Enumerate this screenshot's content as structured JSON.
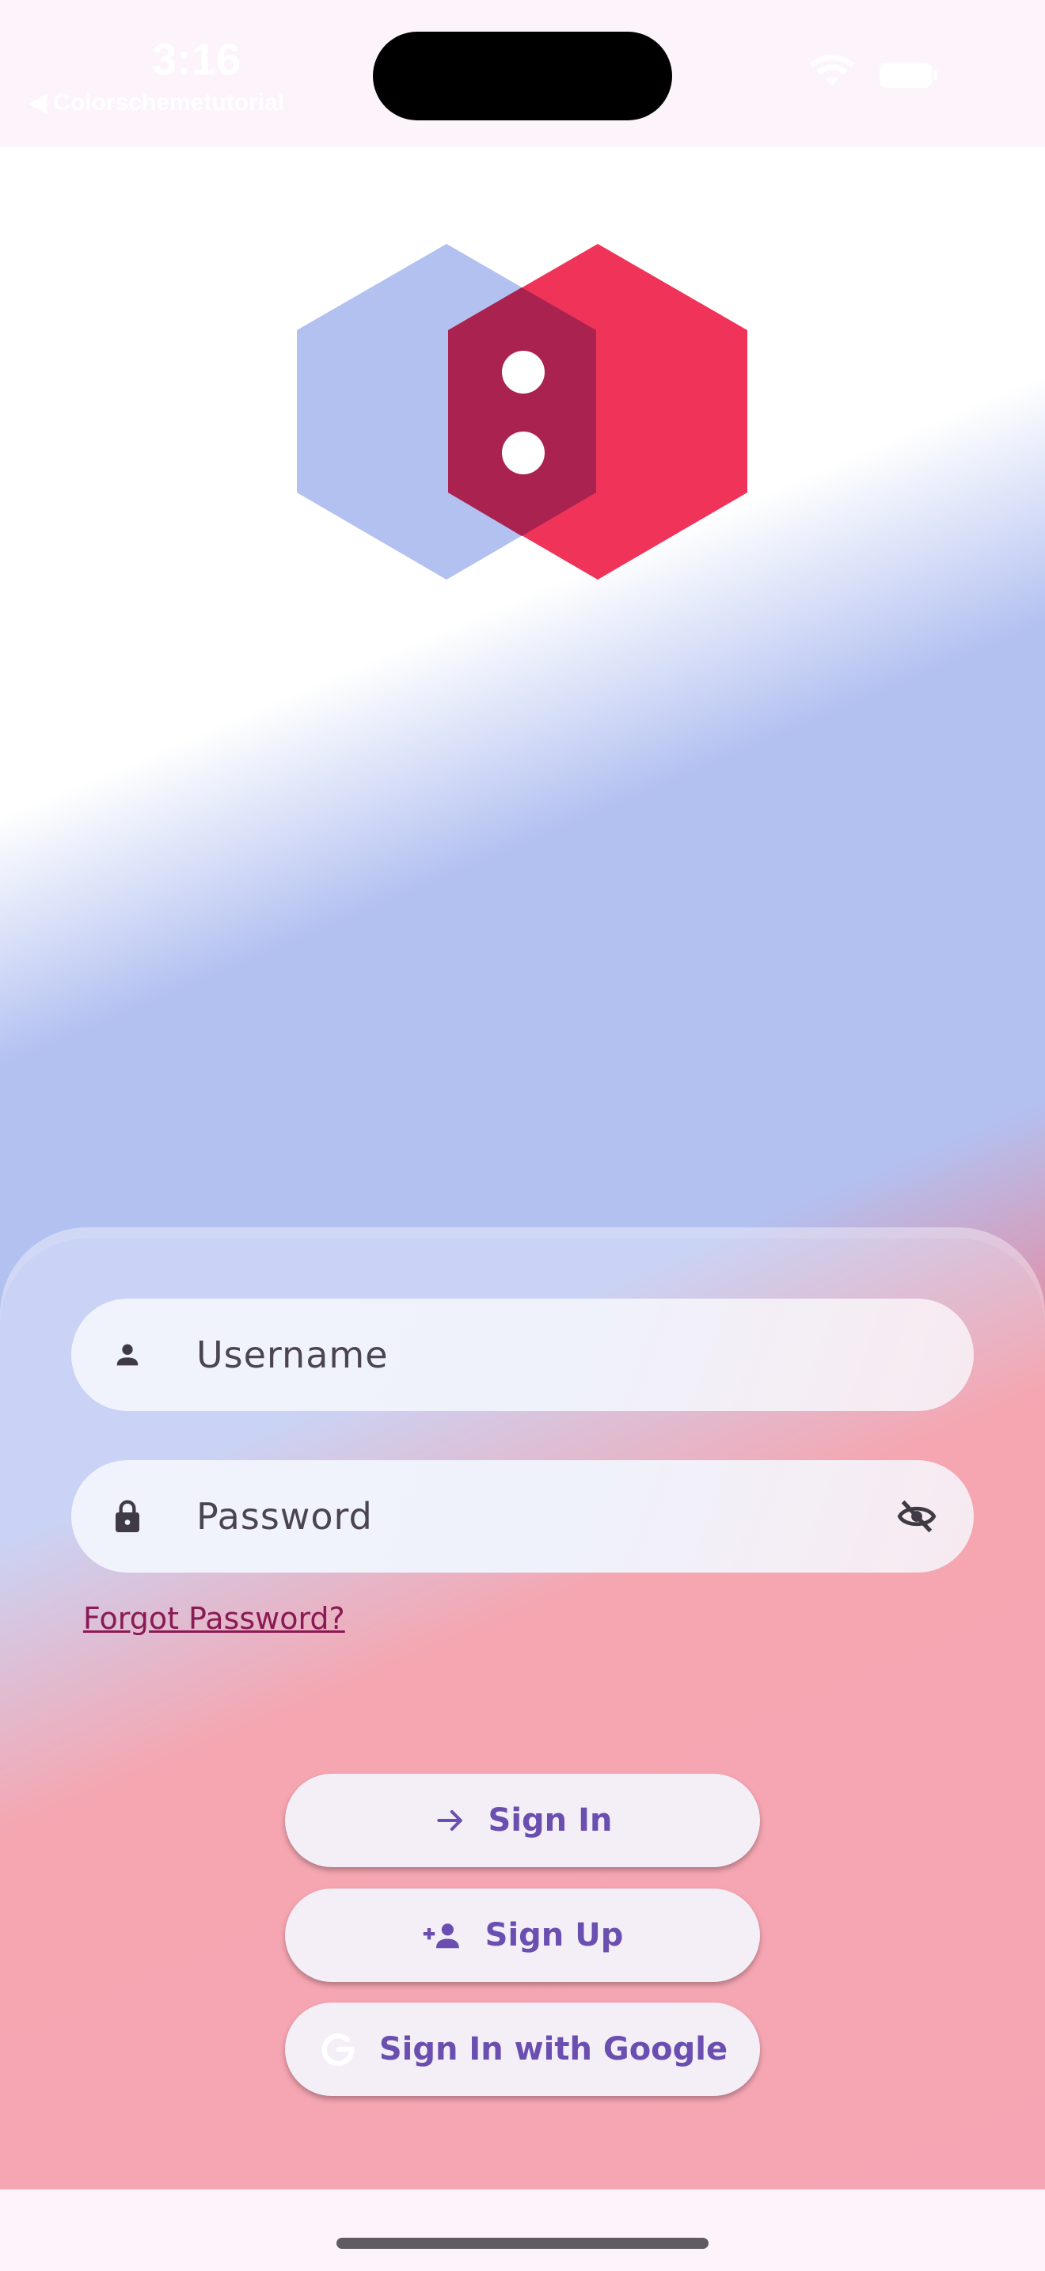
{
  "status_bar": {
    "time": "3:16",
    "back_label": "◀ Colorschemetutorial",
    "wifi_icon": "wifi-icon",
    "battery_icon": "battery-icon"
  },
  "logo": {
    "icon": "hexagon-logo-icon",
    "colors": {
      "left_hex": "#b3c1f1",
      "right_hex": "#f03358",
      "overlap": "#aa2350",
      "dots": "#ffffff"
    }
  },
  "form": {
    "username": {
      "placeholder": "Username",
      "value": "",
      "icon": "person-icon"
    },
    "password": {
      "placeholder": "Password",
      "value": "",
      "icon": "lock-icon",
      "toggle_icon": "visibility-off-icon"
    },
    "forgot_password": "Forgot Password?"
  },
  "actions": {
    "sign_in": {
      "label": "Sign In",
      "icon": "arrow-right-icon"
    },
    "sign_up": {
      "label": "Sign Up",
      "icon": "person-add-icon"
    },
    "google": {
      "label": "Sign In with Google",
      "icon": "google-g-icon"
    }
  },
  "theme": {
    "accent_text": "#6a4fb0",
    "link_color": "#8a1a54",
    "gradient_blue": "#b3c1f1",
    "gradient_pink": "#f27f94"
  }
}
